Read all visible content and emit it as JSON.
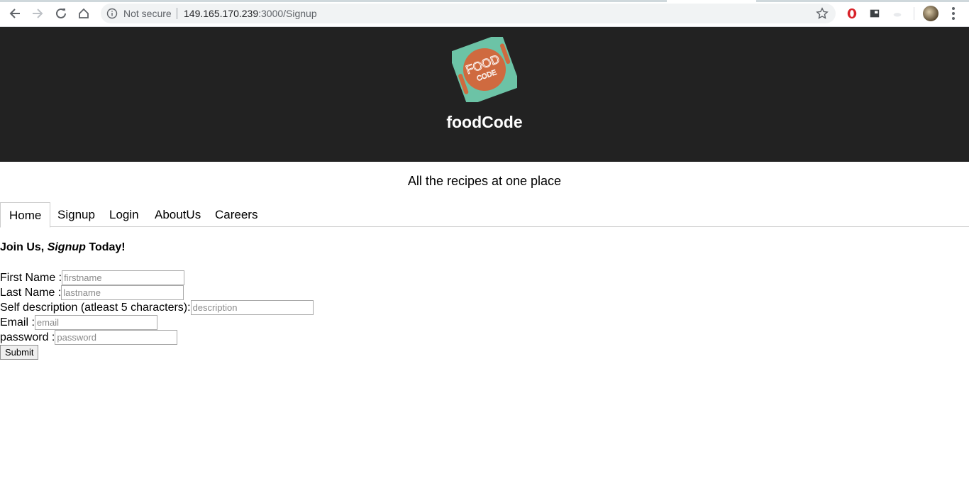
{
  "browser": {
    "security_label": "Not secure",
    "url_host": "149.165.170.239",
    "url_rest": ":3000/Signup"
  },
  "header": {
    "logo_text_top": "FOOD",
    "logo_text_bottom": "CODE",
    "site_name": "foodCode"
  },
  "tagline": "All the recipes at one place",
  "tabs": [
    {
      "label": "Home"
    },
    {
      "label": "Signup"
    },
    {
      "label": "Login"
    },
    {
      "label": "AboutUs"
    },
    {
      "label": "Careers"
    }
  ],
  "form": {
    "title_prefix": "Join Us, ",
    "title_em": "Signup",
    "title_suffix": " Today!",
    "fields": [
      {
        "label": "First Name :",
        "placeholder": "firstname"
      },
      {
        "label": "Last Name :",
        "placeholder": "lastname"
      },
      {
        "label": "Self description (atleast 5 characters):",
        "placeholder": "description"
      },
      {
        "label": "Email :",
        "placeholder": "email"
      },
      {
        "label": "password :",
        "placeholder": "password"
      }
    ],
    "submit_label": "Submit"
  },
  "colors": {
    "header_bg": "#222222",
    "logo_teal": "#6cc3a6",
    "logo_orange": "#cf6a3f"
  }
}
